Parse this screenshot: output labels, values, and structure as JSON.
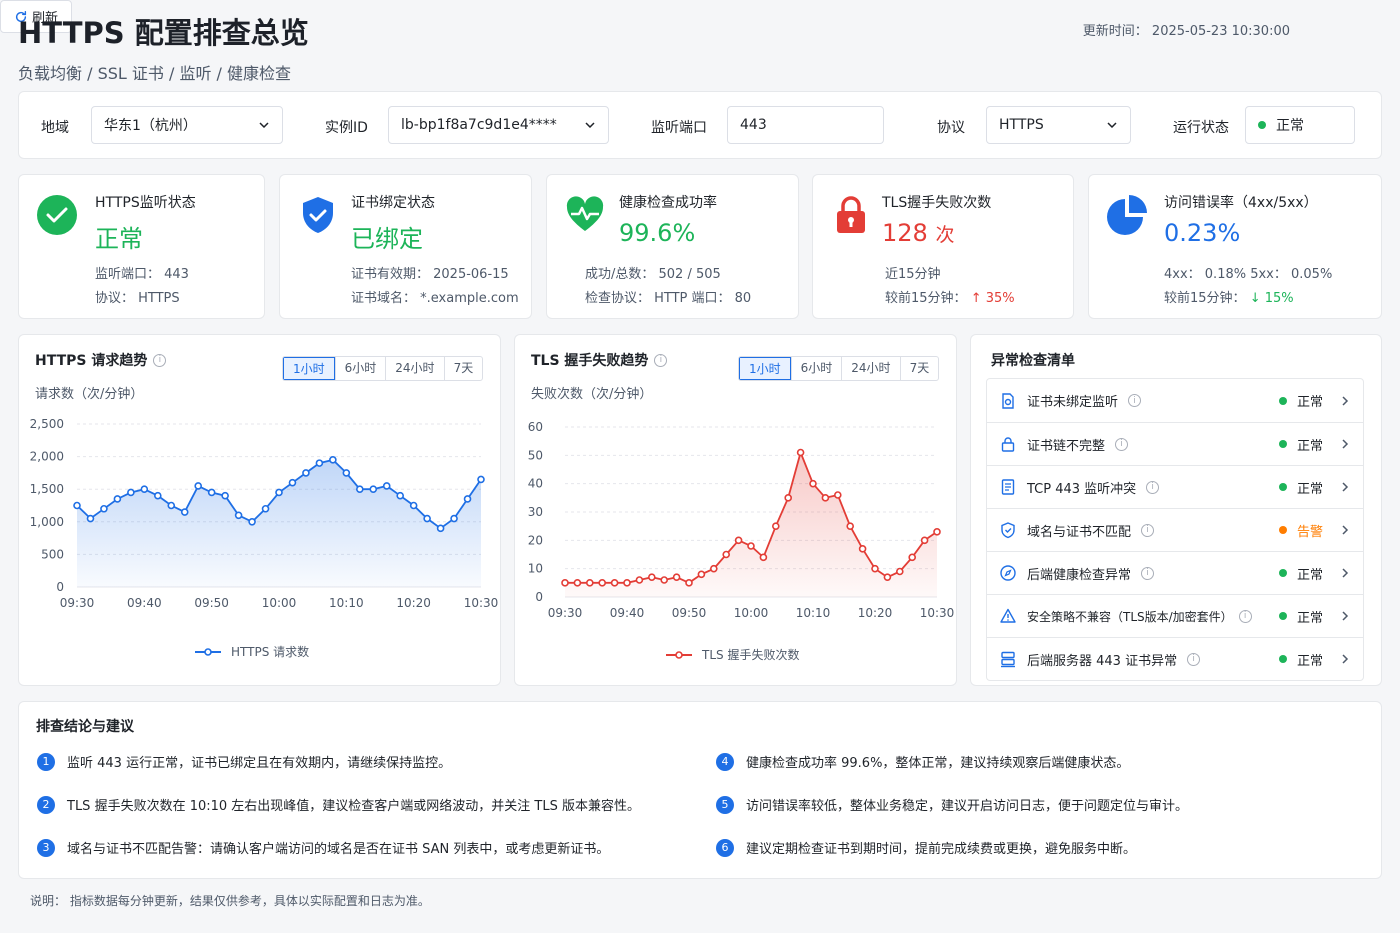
{
  "header": {
    "title": "HTTPS 配置排查总览",
    "breadcrumb": "负载均衡 / SSL 证书 / 监听 / 健康检查",
    "update_time": "更新时间： 2025-05-23 10:30:00",
    "refresh_label": "刷新"
  },
  "filters": {
    "region_label": "地域",
    "region_value": "华东1（杭州）",
    "instance_label": "实例ID",
    "instance_value": "lb-bp1f8a7c9d1e4****",
    "port_label": "监听端口",
    "port_value": "443",
    "protocol_label": "协议",
    "protocol_value": "HTTPS",
    "status_label": "运行状态",
    "status_value": "正常"
  },
  "kpis": [
    {
      "title": "HTTPS监听状态",
      "value": "正常",
      "line1": "监听端口： 443",
      "line2": "协议： HTTPS"
    },
    {
      "title": "证书绑定状态",
      "value": "已绑定",
      "line1": "证书有效期： 2025-06-15",
      "line2": "证书域名： *.example.com"
    },
    {
      "title": "健康检查成功率",
      "value": "99.6%",
      "line1": "成功/总数：  502 / 505",
      "line2": "检查协议： HTTP      端口： 80"
    },
    {
      "title": "TLS握手失败次数",
      "value": "128",
      "unit": "次",
      "line1": "近15分钟",
      "line2": "较前15分钟：",
      "change": "↑ 35%"
    },
    {
      "title": "访问错误率（4xx/5xx）",
      "value": "0.23%",
      "line1": "4xx： 0.18%      5xx： 0.05%",
      "line2": "较前15分钟：",
      "change": "↓ 15%"
    }
  ],
  "colors": {
    "primary": "#1f6fe5",
    "success": "#1db459",
    "danger": "#e33d36",
    "warning": "#ff7d00"
  },
  "ranges": [
    "1小时",
    "6小时",
    "24小时",
    "7天"
  ],
  "https_chart": {
    "title": "HTTPS 请求趋势",
    "sub": "请求数（次/分钟）",
    "legend": "HTTPS 请求数",
    "chart_data": {
      "type": "area",
      "x_ticks": [
        "09:30",
        "09:40",
        "09:50",
        "10:00",
        "10:10",
        "10:20",
        "10:30"
      ],
      "y_ticks": [
        "0",
        "500",
        "1,000",
        "1,500",
        "2,000",
        "2,500"
      ],
      "ylim": [
        0,
        2500
      ],
      "series": [
        {
          "name": "HTTPS 请求数",
          "values": [
            1250,
            1050,
            1200,
            1350,
            1450,
            1500,
            1400,
            1250,
            1150,
            1550,
            1450,
            1400,
            1100,
            1000,
            1200,
            1450,
            1600,
            1750,
            1900,
            1950,
            1750,
            1500,
            1500,
            1550,
            1400,
            1250,
            1050,
            900,
            1050,
            1350,
            1650
          ]
        }
      ]
    }
  },
  "tls_chart": {
    "title": "TLS 握手失败趋势",
    "sub": "失败次数（次/分钟）",
    "legend": "TLS 握手失败次数",
    "chart_data": {
      "type": "area",
      "x_ticks": [
        "09:30",
        "09:40",
        "09:50",
        "10:00",
        "10:10",
        "10:20",
        "10:30"
      ],
      "y_ticks": [
        "0",
        "10",
        "20",
        "30",
        "40",
        "50",
        "60"
      ],
      "ylim": [
        0,
        60
      ],
      "series": [
        {
          "name": "TLS 握手失败次数",
          "values": [
            5,
            5,
            5,
            5,
            5,
            5,
            6,
            7,
            6,
            7,
            5,
            8,
            10,
            15,
            20,
            18,
            14,
            25,
            35,
            51,
            40,
            35,
            36,
            25,
            17,
            10,
            7,
            9,
            14,
            20,
            23
          ]
        }
      ]
    }
  },
  "checklist": {
    "title": "异常检查清单",
    "items": [
      {
        "label": "证书未绑定监听",
        "status": "正常",
        "level": "ok",
        "icon": "cert-icon"
      },
      {
        "label": "证书链不完整",
        "status": "正常",
        "level": "ok",
        "icon": "lock-icon"
      },
      {
        "label": "TCP 443 监听冲突",
        "status": "正常",
        "level": "ok",
        "icon": "document-icon"
      },
      {
        "label": "域名与证书不匹配",
        "status": "告警",
        "level": "warn",
        "icon": "shield-check-icon"
      },
      {
        "label": "后端健康检查异常",
        "status": "正常",
        "level": "ok",
        "icon": "compass-icon"
      },
      {
        "label": "安全策略不兼容（TLS版本/加密套件）",
        "status": "正常",
        "level": "ok",
        "icon": "warning-icon"
      },
      {
        "label": "后端服务器 443 证书异常",
        "status": "正常",
        "level": "ok",
        "icon": "server-icon"
      }
    ]
  },
  "conclusions": {
    "title": "排查结论与建议",
    "items": [
      {
        "num": "1",
        "text": "监听 443 运行正常，证书已绑定且在有效期内，请继续保持监控。"
      },
      {
        "num": "2",
        "text": "TLS 握手失败次数在 10:10 左右出现峰值，建议检查客户端或网络波动，并关注 TLS 版本兼容性。"
      },
      {
        "num": "3",
        "text": "域名与证书不匹配告警：请确认客户端访问的域名是否在证书 SAN 列表中，或考虑更新证书。"
      },
      {
        "num": "4",
        "text": "健康检查成功率 99.6%，整体正常，建议持续观察后端健康状态。"
      },
      {
        "num": "5",
        "text": "访问错误率较低，整体业务稳定，建议开启访问日志，便于问题定位与审计。"
      },
      {
        "num": "6",
        "text": "建议定期检查证书到期时间，提前完成续费或更换，避免服务中断。"
      }
    ]
  },
  "footnote": "说明：  指标数据每分钟更新，结果仅供参考，具体以实际配置和日志为准。"
}
